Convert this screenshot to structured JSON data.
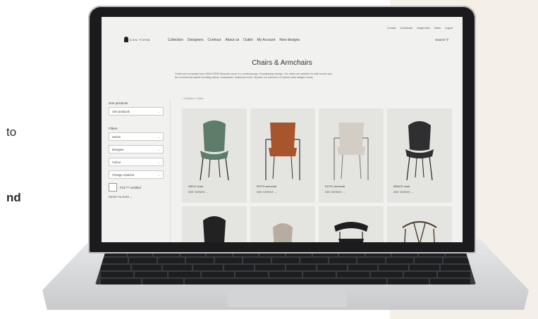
{
  "side_text": {
    "line1": "to",
    "line2": "nd"
  },
  "site": {
    "top_links": [
      "Contact",
      "Downloads",
      "Image bank",
      "News",
      "Logout"
    ],
    "logo_text": "DAN FORM",
    "nav": [
      "Collection",
      "Designers",
      "Contract",
      "About us",
      "Outlet",
      "My Account",
      "New designs"
    ],
    "search_label": "Search",
    "page_title": "Chairs & Armchairs",
    "intro_line1": "Chairs and armchairs from DAN-FORM Denmark come in a contemporary, Scandinavian design. Our chairs are suitable for both homes and",
    "intro_line2": "the commercial market including offices, restaurants, hotels and more. Browse our collection of Danish chair designs below.",
    "breadcrumb": "< Collection / Chairs"
  },
  "sidebar": {
    "sort_label": "Sort products",
    "sort_select": "Sort products",
    "filters_label": "Filters",
    "filters": [
      "Series",
      "Designer",
      "Colour",
      "Change material"
    ],
    "checkbox_label": "FSC™ certified",
    "reset_label": "RESET FILTERS →"
  },
  "products": [
    {
      "name": "ARCH chair",
      "link": "SEE SERIES →",
      "color": "#5d7d6a"
    },
    {
      "name": "ROTO armchair",
      "link": "SEE SERIES →",
      "color": "#a8542c"
    },
    {
      "name": "ROTO armchair",
      "link": "SEE SERIES →",
      "color": "#d3cec5"
    },
    {
      "name": "BRACE chair",
      "link": "SEE SERIES →",
      "color": "#2f2f31"
    }
  ],
  "products_row2": [
    {
      "color": "#222222"
    },
    {
      "color": "#b6aca0"
    },
    {
      "color": "#1e1e1e"
    },
    {
      "color": "#4a3b2a"
    }
  ]
}
